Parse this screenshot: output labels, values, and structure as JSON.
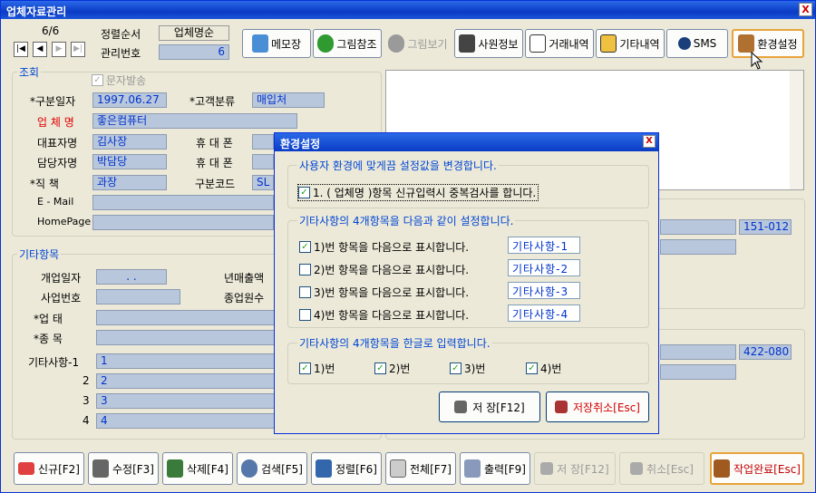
{
  "window": {
    "title": "업체자료관리",
    "close": "X"
  },
  "nav": {
    "record": "6/6",
    "first": "|◀",
    "prev": "◀",
    "next": "▶",
    "last": "▶|"
  },
  "header": {
    "sort_label": "정렬순서",
    "sort_value": "업체명순",
    "id_label": "관리번호",
    "id_value": "6"
  },
  "toolbar": [
    {
      "label": "메모장",
      "icon": "memo-icon"
    },
    {
      "label": "그림참조",
      "icon": "tree-icon"
    },
    {
      "label": "그림보기",
      "icon": "tree-gray-icon"
    },
    {
      "label": "사원정보",
      "icon": "person-icon"
    },
    {
      "label": "거래내역",
      "icon": "document-icon"
    },
    {
      "label": "기타내역",
      "icon": "bag-icon"
    },
    {
      "label": "SMS",
      "icon": "sms-icon"
    },
    {
      "label": "환경설정",
      "icon": "tools-icon"
    }
  ],
  "lookup": {
    "title": "조회",
    "sms_label": "문자발송",
    "date_label": "*구분일자",
    "date_value": "1997.06.27",
    "ctype_label": "*고객분류",
    "ctype_value": "매입처",
    "company_label": "업 체 명",
    "company_value": "좋은컴퓨터",
    "ceo_label": "대표자명",
    "ceo_value": "김사장",
    "mobile1_label": "휴 대 폰",
    "manager_label": "담당자명",
    "manager_value": "박담당",
    "mobile2_label": "휴 대 폰",
    "position_label": "*직  책",
    "position_value": "과장",
    "code_label": "구분코드",
    "code_value": "SL",
    "email_label": "E - Mail",
    "homepage_label": "HomePage"
  },
  "right": {
    "zip1": "151-012",
    "zip2": "422-080"
  },
  "etc": {
    "title": "기타항목",
    "open_label": "개업일자",
    "open_value": ".  .",
    "sales_label": "년매출액",
    "bizno_label": "사업번호",
    "emp_label": "종업원수",
    "biztype_label": "*업    태",
    "bizitem_label": "*종    목",
    "etc1_label": "기타사항-1",
    "etc1_value": "1",
    "etc2_label": "2",
    "etc2_value": "2",
    "etc3_label": "3",
    "etc3_value": "3",
    "etc4_label": "4",
    "etc4_value": "4"
  },
  "dialog": {
    "title": "환경설정",
    "g1_title": "사용자 환경에 맞게끔 설정값을 변경합니다.",
    "g1_opt": "1. ( 업체명 )항목 신규입력시 중복검사를 합니다.",
    "g2_title": "기타사항의 4개항목을 다음과 같이 설정합니다.",
    "opts": [
      {
        "label": "1)번 항목을 다음으로 표시합니다.",
        "value": "기타사항-1",
        "checked": true
      },
      {
        "label": "2)번 항목을 다음으로 표시합니다.",
        "value": "기타사항-2",
        "checked": false
      },
      {
        "label": "3)번 항목을 다음으로 표시합니다.",
        "value": "기타사항-3",
        "checked": false
      },
      {
        "label": "4)번 항목을 다음으로 표시합니다.",
        "value": "기타사항-4",
        "checked": false
      }
    ],
    "g3_title": "기타사항의 4개항목을 한글로 입력합니다.",
    "kor": [
      "1)번",
      "2)번",
      "3)번",
      "4)번"
    ],
    "save": "저 장[F12]",
    "cancel": "저장취소[Esc]"
  },
  "bottom": [
    {
      "label": "신규[F2]",
      "icon": "new-icon"
    },
    {
      "label": "수정[F3]",
      "icon": "edit-icon"
    },
    {
      "label": "삭제[F4]",
      "icon": "delete-icon"
    },
    {
      "label": "검색[F5]",
      "icon": "search-icon"
    },
    {
      "label": "정렬[F6]",
      "icon": "sort-icon"
    },
    {
      "label": "전체[F7]",
      "icon": "list-icon"
    },
    {
      "label": "출력[F9]",
      "icon": "print-icon"
    },
    {
      "label": "저 장[F12]",
      "icon": "save-icon"
    },
    {
      "label": "취소[Esc]",
      "icon": "cancel-icon"
    },
    {
      "label": "작업완료[Esc]",
      "icon": "exit-door-icon"
    }
  ]
}
